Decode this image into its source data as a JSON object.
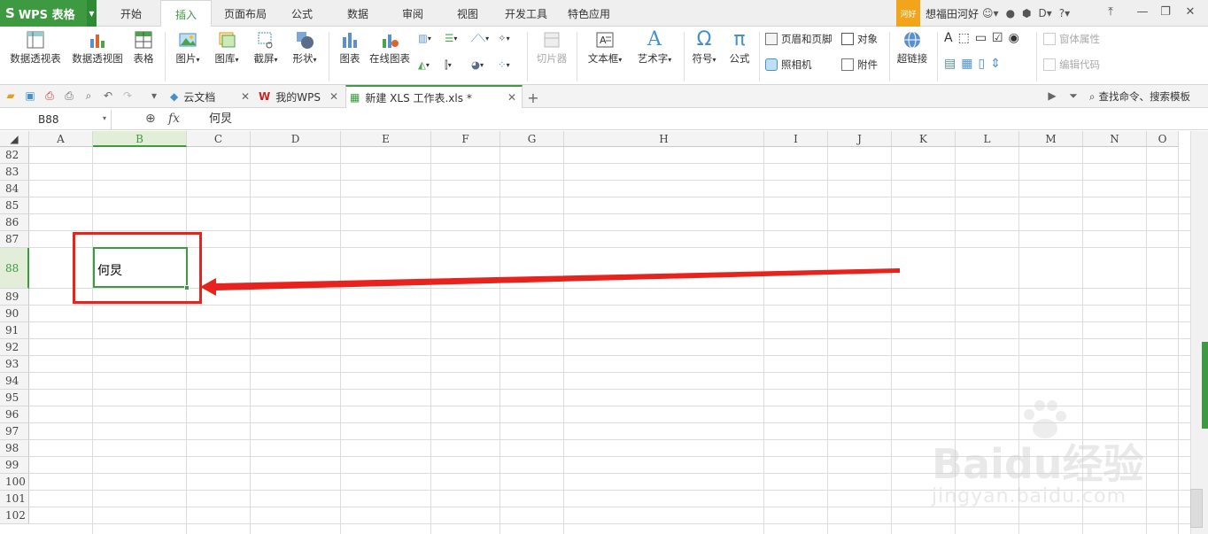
{
  "app": {
    "name": "WPS 表格",
    "logo": "S"
  },
  "ribbon_tabs": [
    "开始",
    "插入",
    "页面布局",
    "公式",
    "数据",
    "审阅",
    "视图",
    "开发工具",
    "特色应用"
  ],
  "active_tab": "插入",
  "user": {
    "badge": "河好",
    "name": "想福田河好"
  },
  "toolbar": {
    "pivot_table": "数据透视表",
    "pivot_chart": "数据透视图",
    "table": "表格",
    "picture": "图片",
    "gallery": "图库",
    "screenshot": "截屏",
    "shape": "形状",
    "chart": "图表",
    "online_chart": "在线图表",
    "slicer": "切片器",
    "textbox": "文本框",
    "wordart": "艺术字",
    "symbol": "符号",
    "formula": "公式",
    "header_footer": "页眉和页脚",
    "object": "对象",
    "camera": "照相机",
    "attachment": "附件",
    "hyperlink": "超链接",
    "form_props": "窗体属性",
    "edit_code": "编辑代码"
  },
  "doc_tabs": [
    {
      "label": "云文档"
    },
    {
      "label": "我的WPS"
    },
    {
      "label": "新建 XLS 工作表.xls *"
    }
  ],
  "search_label": "查找命令、搜索模板",
  "name_box": "B88",
  "fx": "fx",
  "formula_value": "何炅",
  "columns": [
    "A",
    "B",
    "C",
    "D",
    "E",
    "F",
    "G",
    "H",
    "I",
    "J",
    "K",
    "L",
    "M",
    "N",
    "O"
  ],
  "rows": [
    "82",
    "83",
    "84",
    "85",
    "86",
    "87",
    "88",
    "89",
    "90",
    "91",
    "92",
    "93",
    "94",
    "95",
    "96",
    "97",
    "98",
    "99",
    "100",
    "101",
    "102"
  ],
  "selected_cell": {
    "col": "B",
    "row": "88",
    "value": "何炅"
  },
  "watermark": {
    "brand": "Baidu经验",
    "url": "jingyan.baidu.com"
  },
  "colors": {
    "accent": "#3d9a40",
    "annotation": "#e8221c",
    "badge": "#f2a51a"
  }
}
